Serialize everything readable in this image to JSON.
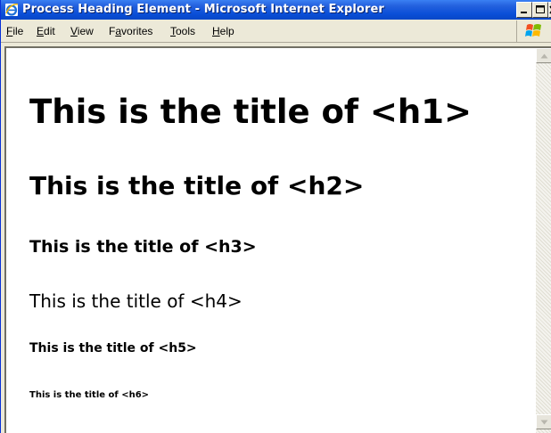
{
  "window": {
    "title": "Process Heading Element - Microsoft Internet Explorer"
  },
  "menu": {
    "file": {
      "accel": "F",
      "rest": "ile"
    },
    "edit": {
      "accel": "E",
      "rest": "dit"
    },
    "view": {
      "accel": "V",
      "rest": "iew"
    },
    "favorites": {
      "pre": "F",
      "accel": "a",
      "rest": "vorites"
    },
    "tools": {
      "accel": "T",
      "rest": "ools"
    },
    "help": {
      "accel": "H",
      "rest": "elp"
    }
  },
  "page": {
    "h1": "This is the title of <h1>",
    "h2": "This is the title of <h2>",
    "h3": "This is the title of <h3>",
    "h4": "This is the title of <h4>",
    "h5": "This is the title of <h5>",
    "h6": "This is the title of <h6>"
  },
  "icons": {
    "app": "internet-explorer-icon",
    "minimize": "minimize-icon",
    "maximize": "maximize-icon",
    "close": "close-icon",
    "throbber": "windows-logo-icon",
    "scroll_up": "scroll-up-arrow-icon",
    "scroll_down": "scroll-down-arrow-icon"
  },
  "colors": {
    "titlebar": "#0a4fd8",
    "chrome": "#ece9d8",
    "page_background": "#ffffff"
  }
}
